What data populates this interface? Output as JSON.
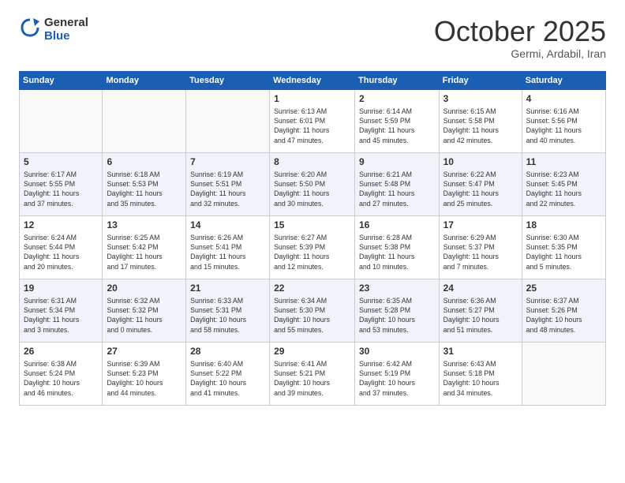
{
  "header": {
    "logo_line1": "General",
    "logo_line2": "Blue",
    "month": "October 2025",
    "location": "Germi, Ardabil, Iran"
  },
  "weekdays": [
    "Sunday",
    "Monday",
    "Tuesday",
    "Wednesday",
    "Thursday",
    "Friday",
    "Saturday"
  ],
  "weeks": [
    [
      {
        "day": "",
        "info": ""
      },
      {
        "day": "",
        "info": ""
      },
      {
        "day": "",
        "info": ""
      },
      {
        "day": "1",
        "info": "Sunrise: 6:13 AM\nSunset: 6:01 PM\nDaylight: 11 hours\nand 47 minutes."
      },
      {
        "day": "2",
        "info": "Sunrise: 6:14 AM\nSunset: 5:59 PM\nDaylight: 11 hours\nand 45 minutes."
      },
      {
        "day": "3",
        "info": "Sunrise: 6:15 AM\nSunset: 5:58 PM\nDaylight: 11 hours\nand 42 minutes."
      },
      {
        "day": "4",
        "info": "Sunrise: 6:16 AM\nSunset: 5:56 PM\nDaylight: 11 hours\nand 40 minutes."
      }
    ],
    [
      {
        "day": "5",
        "info": "Sunrise: 6:17 AM\nSunset: 5:55 PM\nDaylight: 11 hours\nand 37 minutes."
      },
      {
        "day": "6",
        "info": "Sunrise: 6:18 AM\nSunset: 5:53 PM\nDaylight: 11 hours\nand 35 minutes."
      },
      {
        "day": "7",
        "info": "Sunrise: 6:19 AM\nSunset: 5:51 PM\nDaylight: 11 hours\nand 32 minutes."
      },
      {
        "day": "8",
        "info": "Sunrise: 6:20 AM\nSunset: 5:50 PM\nDaylight: 11 hours\nand 30 minutes."
      },
      {
        "day": "9",
        "info": "Sunrise: 6:21 AM\nSunset: 5:48 PM\nDaylight: 11 hours\nand 27 minutes."
      },
      {
        "day": "10",
        "info": "Sunrise: 6:22 AM\nSunset: 5:47 PM\nDaylight: 11 hours\nand 25 minutes."
      },
      {
        "day": "11",
        "info": "Sunrise: 6:23 AM\nSunset: 5:45 PM\nDaylight: 11 hours\nand 22 minutes."
      }
    ],
    [
      {
        "day": "12",
        "info": "Sunrise: 6:24 AM\nSunset: 5:44 PM\nDaylight: 11 hours\nand 20 minutes."
      },
      {
        "day": "13",
        "info": "Sunrise: 6:25 AM\nSunset: 5:42 PM\nDaylight: 11 hours\nand 17 minutes."
      },
      {
        "day": "14",
        "info": "Sunrise: 6:26 AM\nSunset: 5:41 PM\nDaylight: 11 hours\nand 15 minutes."
      },
      {
        "day": "15",
        "info": "Sunrise: 6:27 AM\nSunset: 5:39 PM\nDaylight: 11 hours\nand 12 minutes."
      },
      {
        "day": "16",
        "info": "Sunrise: 6:28 AM\nSunset: 5:38 PM\nDaylight: 11 hours\nand 10 minutes."
      },
      {
        "day": "17",
        "info": "Sunrise: 6:29 AM\nSunset: 5:37 PM\nDaylight: 11 hours\nand 7 minutes."
      },
      {
        "day": "18",
        "info": "Sunrise: 6:30 AM\nSunset: 5:35 PM\nDaylight: 11 hours\nand 5 minutes."
      }
    ],
    [
      {
        "day": "19",
        "info": "Sunrise: 6:31 AM\nSunset: 5:34 PM\nDaylight: 11 hours\nand 3 minutes."
      },
      {
        "day": "20",
        "info": "Sunrise: 6:32 AM\nSunset: 5:32 PM\nDaylight: 11 hours\nand 0 minutes."
      },
      {
        "day": "21",
        "info": "Sunrise: 6:33 AM\nSunset: 5:31 PM\nDaylight: 10 hours\nand 58 minutes."
      },
      {
        "day": "22",
        "info": "Sunrise: 6:34 AM\nSunset: 5:30 PM\nDaylight: 10 hours\nand 55 minutes."
      },
      {
        "day": "23",
        "info": "Sunrise: 6:35 AM\nSunset: 5:28 PM\nDaylight: 10 hours\nand 53 minutes."
      },
      {
        "day": "24",
        "info": "Sunrise: 6:36 AM\nSunset: 5:27 PM\nDaylight: 10 hours\nand 51 minutes."
      },
      {
        "day": "25",
        "info": "Sunrise: 6:37 AM\nSunset: 5:26 PM\nDaylight: 10 hours\nand 48 minutes."
      }
    ],
    [
      {
        "day": "26",
        "info": "Sunrise: 6:38 AM\nSunset: 5:24 PM\nDaylight: 10 hours\nand 46 minutes."
      },
      {
        "day": "27",
        "info": "Sunrise: 6:39 AM\nSunset: 5:23 PM\nDaylight: 10 hours\nand 44 minutes."
      },
      {
        "day": "28",
        "info": "Sunrise: 6:40 AM\nSunset: 5:22 PM\nDaylight: 10 hours\nand 41 minutes."
      },
      {
        "day": "29",
        "info": "Sunrise: 6:41 AM\nSunset: 5:21 PM\nDaylight: 10 hours\nand 39 minutes."
      },
      {
        "day": "30",
        "info": "Sunrise: 6:42 AM\nSunset: 5:19 PM\nDaylight: 10 hours\nand 37 minutes."
      },
      {
        "day": "31",
        "info": "Sunrise: 6:43 AM\nSunset: 5:18 PM\nDaylight: 10 hours\nand 34 minutes."
      },
      {
        "day": "",
        "info": ""
      }
    ]
  ]
}
